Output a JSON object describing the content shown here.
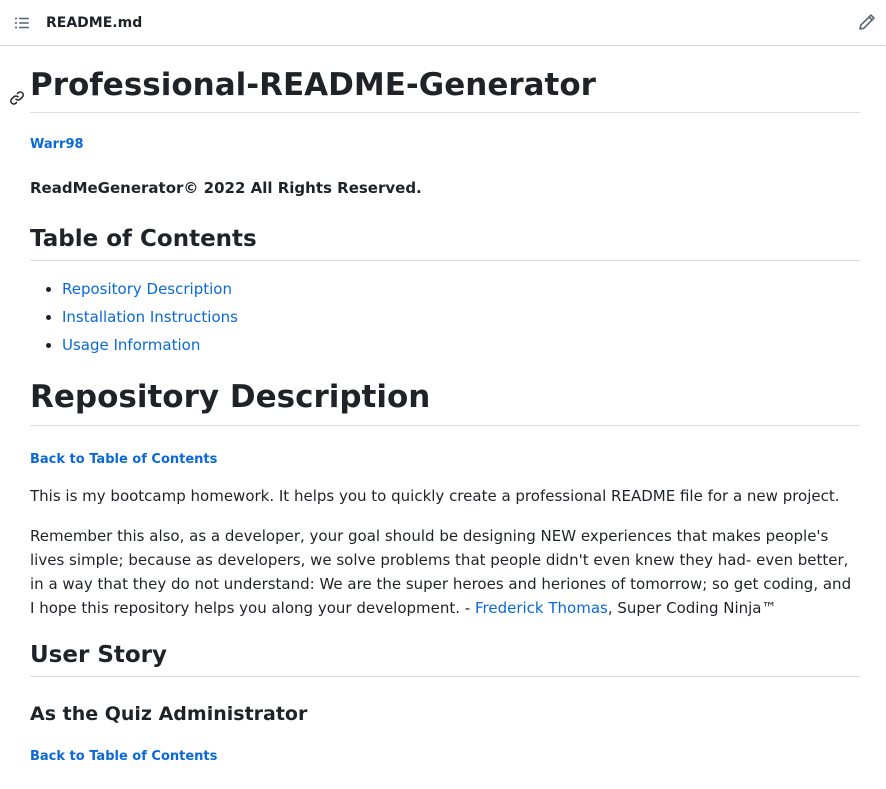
{
  "header": {
    "toc_icon": "list-unordered-icon",
    "filename": "README.md",
    "edit_icon": "pencil-icon"
  },
  "readme": {
    "title": "Professional-README-Generator",
    "anchor_icon": "link-icon",
    "author": "Warr98",
    "copyright": "ReadMeGenerator© 2022 All Rights Reserved.",
    "toc_heading": "Table of Contents",
    "toc_items": [
      {
        "label": "Repository Description"
      },
      {
        "label": "Installation Instructions"
      },
      {
        "label": "Usage Information"
      }
    ],
    "repo_description": {
      "heading": "Repository Description",
      "back_link": "Back to Table of Contents",
      "paragraph1": "This is my bootcamp homework. It helps you to quickly create a professional README file for a new project.",
      "paragraph2_start": "Remember this also, as a developer, your goal should be designing NEW experiences that makes people's lives simple; because as developers, we solve problems that people didn't even knew they had- even better, in a way that they do not understand: We are the super heroes and heriones of tomorrow; so get coding, and I hope this repository helps you along your development. - ",
      "paragraph2_link": "Frederick Thomas",
      "paragraph2_end": ", Super Coding Ninja™"
    },
    "user_story": {
      "heading": "User Story",
      "subheading": "As the Quiz Administrator",
      "back_link": "Back to Table of Contents"
    }
  },
  "colors": {
    "link": "#0969da",
    "text": "#1f2328",
    "border": "#d8dee4"
  }
}
